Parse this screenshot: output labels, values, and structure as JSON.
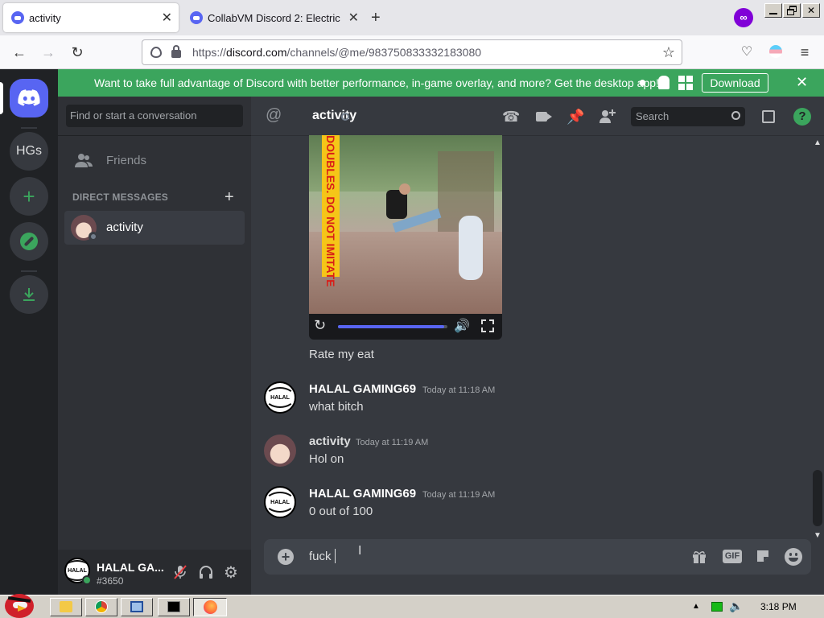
{
  "browser": {
    "tabs": [
      {
        "label": "activity",
        "active": true
      },
      {
        "label": "CollabVM Discord 2: Electric",
        "active": false
      }
    ],
    "url_prefix": "https://",
    "url_domain": "discord.com",
    "url_path": "/channels/@me/983750833332183080"
  },
  "banner": {
    "text": "Want to take full advantage of Discord with better performance, in-game overlay, and more? Get the desktop app!",
    "download_label": "Download"
  },
  "guilds": {
    "server_label": "HGs"
  },
  "sidebar": {
    "search_placeholder": "Find or start a conversation",
    "friends_label": "Friends",
    "dm_header": "DIRECT MESSAGES",
    "dm_items": [
      {
        "label": "activity"
      }
    ]
  },
  "user_panel": {
    "username": "HALAL GA...",
    "tag": "#3650"
  },
  "chat": {
    "channel_name": "activity",
    "search_placeholder": "Search",
    "video": {
      "overlay_text": "DOUBLES. DO NOT IMITATE",
      "progress": 0.97
    },
    "video_caption": "Rate my eat",
    "messages": [
      {
        "author": "HALAL GAMING69",
        "time": "Today at 11:18 AM",
        "text": "what bitch",
        "avatar": "halal"
      },
      {
        "author": "activity",
        "time": "Today at 11:19 AM",
        "text": "Hol on",
        "avatar": "anime"
      },
      {
        "author": "HALAL GAMING69",
        "time": "Today at 11:19 AM",
        "text": "0 out of 100",
        "avatar": "halal"
      }
    ],
    "composer_value": "fuck ",
    "gif_label": "GIF",
    "halal_avatar_text": "HALAL"
  },
  "taskbar": {
    "clock": "3:18 PM"
  },
  "colors": {
    "blurple": "#5865f2",
    "green": "#3ba55d",
    "bg_primary": "#36393f",
    "bg_secondary": "#2f3136",
    "bg_tertiary": "#202225"
  }
}
